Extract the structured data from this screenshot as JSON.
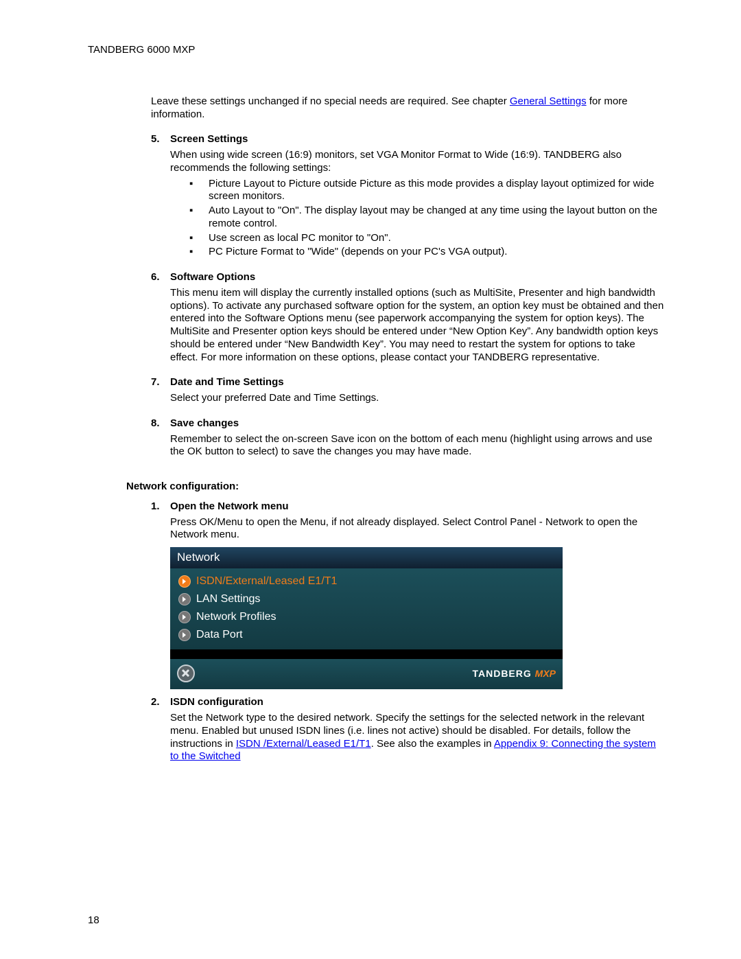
{
  "header": "TANDBERG 6000 MXP",
  "page_number": "18",
  "intro": {
    "before_link": "Leave these settings unchanged if no special needs are required. See chapter ",
    "link": "General Settings",
    "after_link": " for more information."
  },
  "items": [
    {
      "num": "5.",
      "title": "Screen Settings",
      "body": "When using wide screen (16:9) monitors, set VGA Monitor Format to Wide (16:9). TANDBERG also recommends the following settings:",
      "bullets": [
        "Picture Layout to Picture outside Picture as this mode provides a display layout optimized for wide screen monitors.",
        "Auto Layout to \"On\". The display layout may be changed at any time using the layout button on the remote control.",
        "Use screen as local PC monitor to \"On\".",
        "PC Picture Format to \"Wide\" (depends on your PC's VGA output)."
      ]
    },
    {
      "num": "6.",
      "title": "Software Options",
      "body": "This menu item will display the currently installed options (such as MultiSite, Presenter and high bandwidth options). To activate any purchased software option for the system, an option key must be obtained and then entered into the Software Options menu (see paperwork accompanying the system for option keys). The MultiSite and Presenter option keys should be entered under “New Option Key”. Any bandwidth option keys should be entered under “New Bandwidth Key”. You may need to restart the system for options to take effect. For more information on these options, please contact your TANDBERG representative."
    },
    {
      "num": "7.",
      "title": "Date and Time Settings",
      "body": "Select your preferred Date and Time Settings."
    },
    {
      "num": "8.",
      "title": "Save changes",
      "body": "Remember to select the on-screen Save icon on the bottom of each menu (highlight using arrows and use the OK button to select) to save the changes you may have made."
    }
  ],
  "network": {
    "heading": "Network configuration:",
    "items": [
      {
        "num": "1.",
        "title": "Open the Network menu",
        "body": "Press OK/Menu to open the Menu, if not already displayed. Select Control Panel - Network to open the Network menu."
      },
      {
        "num": "2.",
        "title": "ISDN configuration",
        "body_parts": {
          "p1": "Set the Network type to the desired network. Specify the settings for the selected network in the relevant menu. Enabled but unused ISDN lines (i.e. lines not active) should be disabled. For details, follow the instructions in ",
          "link1": "ISDN /External/Leased E1/T1",
          "p2": ". See also the examples in ",
          "link2": "Appendix 9: Connecting the system to the Switched"
        }
      }
    ],
    "screenshot": {
      "title": "Network",
      "menu": [
        {
          "label": "ISDN/External/Leased E1/T1",
          "selected": true
        },
        {
          "label": "LAN Settings",
          "selected": false
        },
        {
          "label": "Network Profiles",
          "selected": false
        },
        {
          "label": "Data Port",
          "selected": false
        }
      ],
      "brand": "TANDBERG",
      "brand_accent": "MXP"
    }
  }
}
